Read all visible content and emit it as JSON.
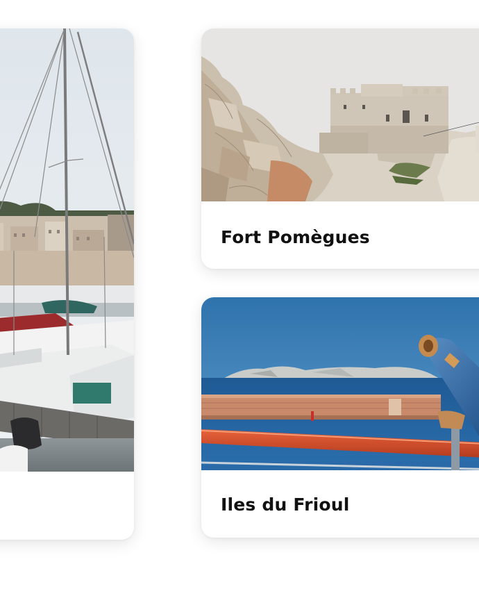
{
  "cards": [
    {
      "title": "",
      "image_subject": "marseille-harbor-sailboats"
    },
    {
      "title": "Fort Pomègues",
      "image_subject": "fort-on-limestone-rocks"
    },
    {
      "title": "Iles du Frioul",
      "image_subject": "frioul-islands-seaview-with-telescope"
    }
  ],
  "colors": {
    "background": "#ffffff",
    "card_background": "#ffffff",
    "title_text": "#111111"
  }
}
